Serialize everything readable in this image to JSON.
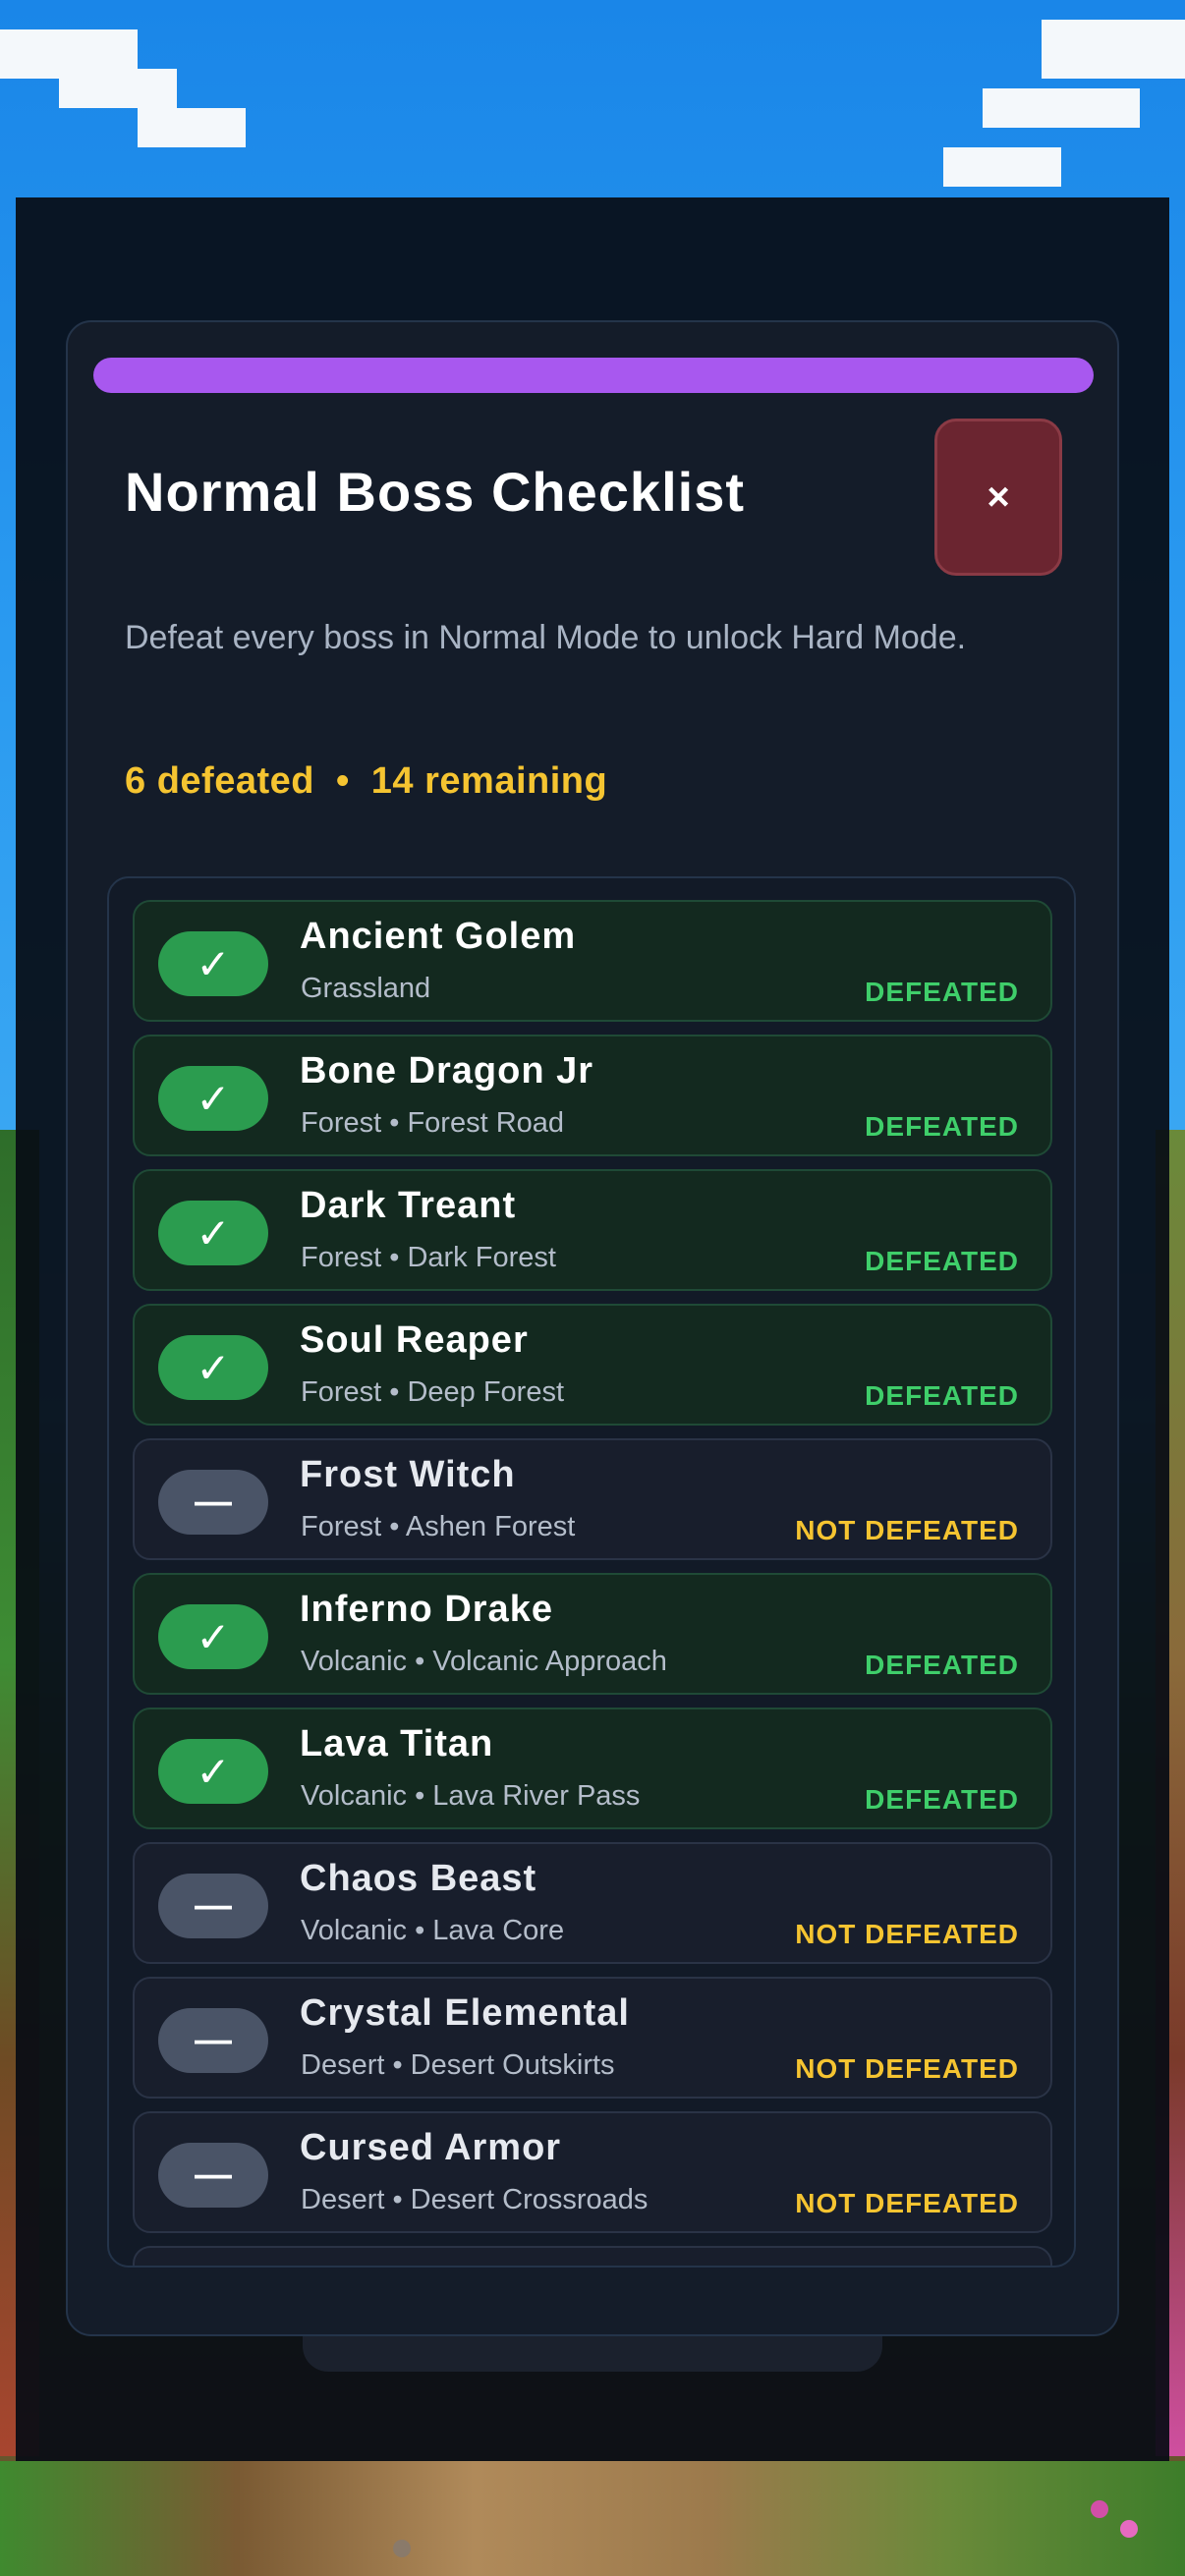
{
  "modal": {
    "title": "Normal Boss Checklist",
    "close_label": "×",
    "subtitle": "Defeat every boss in Normal Mode to unlock Hard Mode.",
    "defeated_count_text": "6 defeated",
    "separator": "•",
    "remaining_count_text": "14 remaining",
    "accent_color": "#a858ef"
  },
  "bosses": [
    {
      "name": "Ancient Golem",
      "location": "Grassland",
      "status": "DEFEATED",
      "icon": "✓"
    },
    {
      "name": "Bone Dragon Jr",
      "location": "Forest  •  Forest Road",
      "status": "DEFEATED",
      "icon": "✓"
    },
    {
      "name": "Dark Treant",
      "location": "Forest  •  Dark Forest",
      "status": "DEFEATED",
      "icon": "✓"
    },
    {
      "name": "Soul Reaper",
      "location": "Forest  •  Deep Forest",
      "status": "DEFEATED",
      "icon": "✓"
    },
    {
      "name": "Frost Witch",
      "location": "Forest  •  Ashen Forest",
      "status": "NOT DEFEATED",
      "icon": "—"
    },
    {
      "name": "Inferno Drake",
      "location": "Volcanic  •  Volcanic Approach",
      "status": "DEFEATED",
      "icon": "✓"
    },
    {
      "name": "Lava Titan",
      "location": "Volcanic  •  Lava River Pass",
      "status": "DEFEATED",
      "icon": "✓"
    },
    {
      "name": "Chaos Beast",
      "location": "Volcanic  •  Lava Core",
      "status": "NOT DEFEATED",
      "icon": "—"
    },
    {
      "name": "Crystal Elemental",
      "location": "Desert  •  Desert Outskirts",
      "status": "NOT DEFEATED",
      "icon": "—"
    },
    {
      "name": "Cursed Armor",
      "location": "Desert  •  Desert Crossroads",
      "status": "NOT DEFEATED",
      "icon": "—"
    }
  ],
  "colors": {
    "defeated": "#3fce6a",
    "not_defeated": "#f5c431",
    "check_on": "#2b9c4f",
    "check_off": "#4a5467"
  }
}
